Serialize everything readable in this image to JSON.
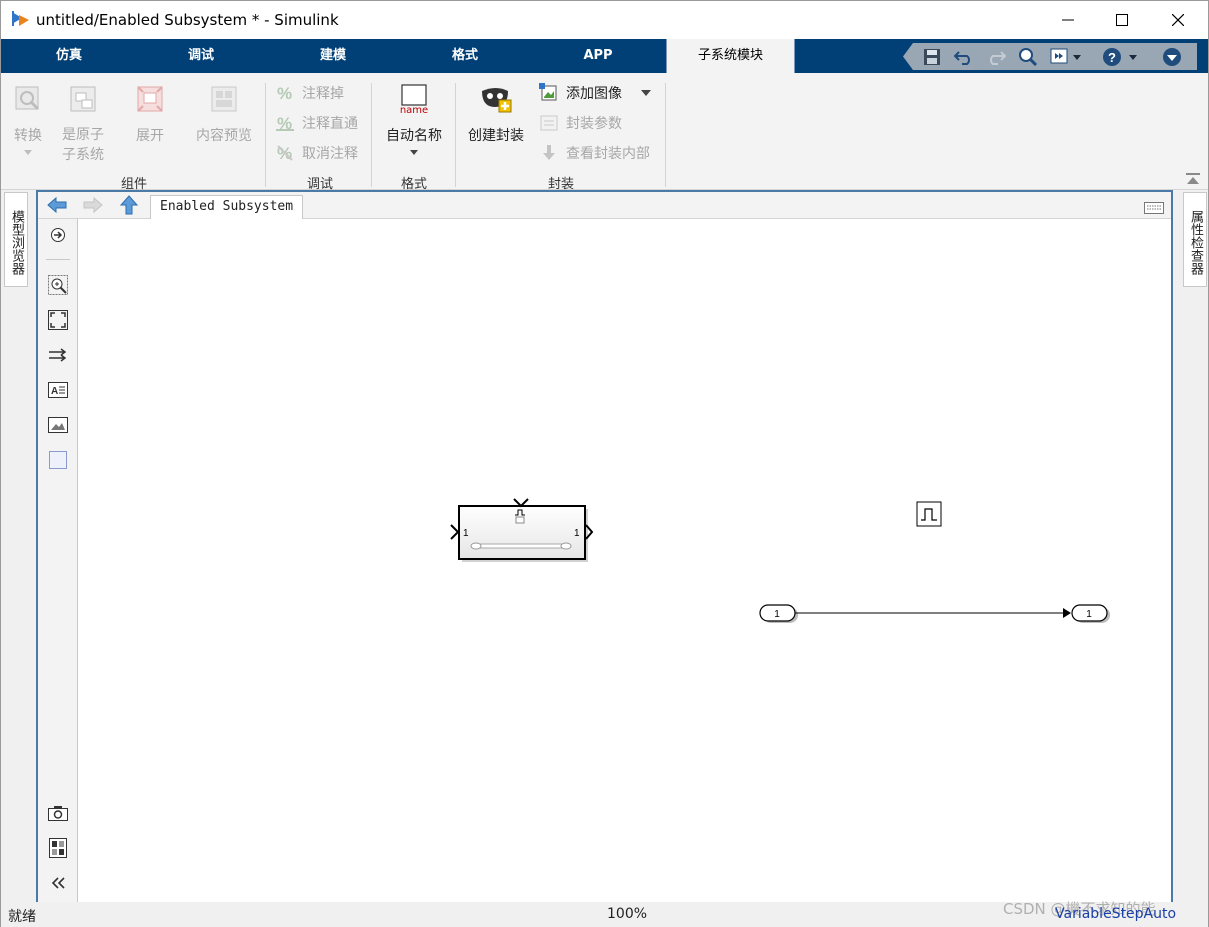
{
  "window": {
    "title": "untitled/Enabled Subsystem * - Simulink",
    "minimize_label": "minimize",
    "maximize_label": "maximize",
    "close_label": "close"
  },
  "tabs": [
    {
      "label": "仿真"
    },
    {
      "label": "调试"
    },
    {
      "label": "建模"
    },
    {
      "label": "格式"
    },
    {
      "label": "APP"
    },
    {
      "label": "子系统模块",
      "active": true
    }
  ],
  "ribbon": {
    "groups": {
      "component": {
        "label": "组件",
        "convert": "转换",
        "atomic_line1": "是原子",
        "atomic_line2": "子系统",
        "expand": "展开",
        "preview": "内容预览"
      },
      "debug": {
        "label": "调试",
        "comment_out": "注释掉",
        "comment_through": "注释直通",
        "uncomment": "取消注释"
      },
      "format": {
        "label": "格式",
        "auto_name": "自动名称",
        "auto_name_icon_text": "name"
      },
      "mask": {
        "label": "封装",
        "create_mask": "创建封装",
        "add_image": "添加图像",
        "mask_params": "封装参数",
        "look_under_mask": "查看封装内部"
      }
    }
  },
  "side_tabs": {
    "left": "模型浏览器",
    "right": "属性检查器"
  },
  "editor": {
    "breadcrumb": "Enabled Subsystem"
  },
  "diagram": {
    "subsystem_block": {
      "in_port": "1",
      "out_port": "1",
      "enable_icon": "pulse-icon"
    },
    "pulse_block_icon": "pulse-icon",
    "inport": {
      "label": "1"
    },
    "outport": {
      "label": "1"
    }
  },
  "status": {
    "left": "就绪",
    "zoom": "100%",
    "watermark": "CSDN @機不求知的能",
    "solver": "VariableStepAuto"
  },
  "colors": {
    "tabstrip": "#004077",
    "editor_border": "#4b7aa8",
    "solver_link": "#1a3fa6"
  }
}
